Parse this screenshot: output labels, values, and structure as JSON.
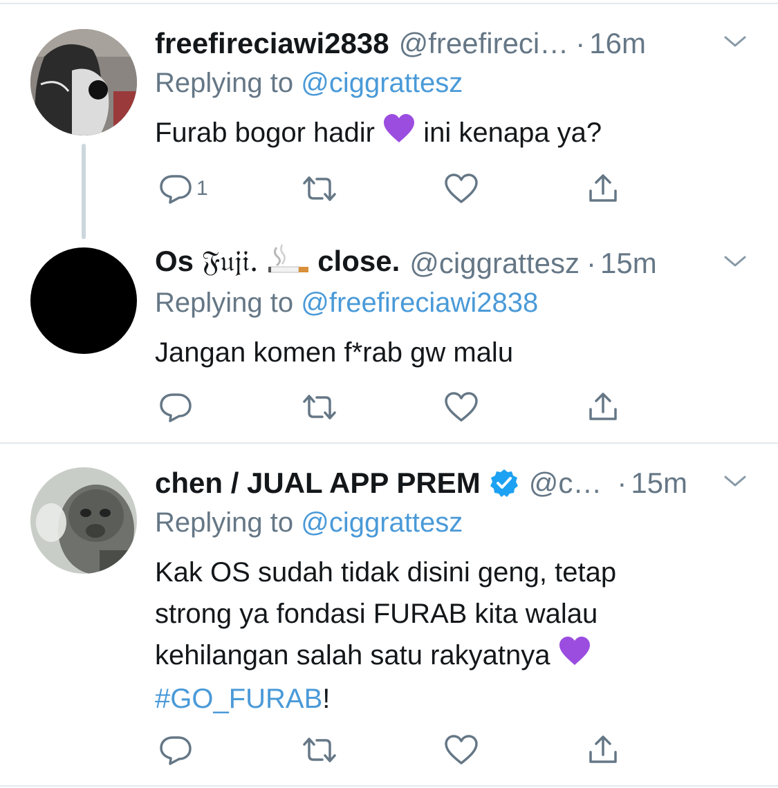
{
  "tweets": [
    {
      "name": "freefireciawi2838",
      "handle": "@freefireci…",
      "sep": "·",
      "time": "16m",
      "replying_prefix": "Replying to ",
      "replying_to": "@ciggrattesz",
      "text_part1": "Furab bogor hadir ",
      "text_part2": " ini kenapa ya?",
      "reply_count": "1"
    },
    {
      "name_part1": "Os ",
      "name_part2": "𝔉𝔲𝔧𝔦.",
      "name_part3": " close.",
      "handle": "@ciggrattesz",
      "sep": "·",
      "time": "15m",
      "replying_prefix": "Replying to ",
      "replying_to": "@freefireciawi2838",
      "text": "Jangan komen f*rab gw malu"
    },
    {
      "name": "chen / JUAL APP PREM",
      "handle": "@c…",
      "sep": "·",
      "time": "15m",
      "replying_prefix": "Replying to ",
      "replying_to": "@ciggrattesz",
      "line1": "Kak OS sudah tidak disini geng, tetap",
      "line2": "strong ya fondasi FURAB kita walau",
      "line3": "kehilangan salah satu rakyatnya ",
      "hashtag": "#GO_FURAB",
      "hashtag_suffix": "!"
    }
  ],
  "colors": {
    "accent": "#4a9ad8",
    "secondary": "#657786",
    "divider": "#e1e8ed",
    "heart_emoji": "#9b4de0",
    "verified": "#1da1f2"
  },
  "icons": [
    "reply-icon",
    "retweet-icon",
    "like-icon",
    "share-icon",
    "chevron-down-icon",
    "verified-icon",
    "purple-heart-icon",
    "cigarette-icon"
  ]
}
